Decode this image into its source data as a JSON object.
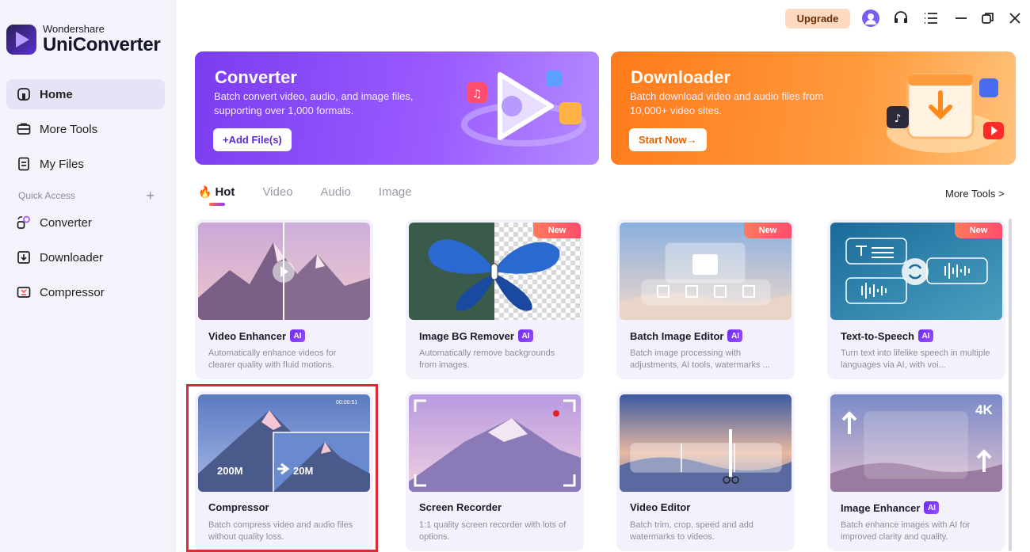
{
  "app": {
    "brand_sub": "Wondershare",
    "brand_main": "UniConverter"
  },
  "sidebar": {
    "items": [
      {
        "label": "Home",
        "icon": "home-icon"
      },
      {
        "label": "More Tools",
        "icon": "toolbox-icon"
      },
      {
        "label": "My Files",
        "icon": "file-icon"
      }
    ],
    "quick_access_label": "Quick Access",
    "quick_items": [
      {
        "label": "Converter",
        "icon": "converter-icon"
      },
      {
        "label": "Downloader",
        "icon": "download-icon"
      },
      {
        "label": "Compressor",
        "icon": "compress-icon"
      }
    ]
  },
  "topbar": {
    "upgrade_label": "Upgrade"
  },
  "banners": {
    "converter": {
      "title": "Converter",
      "desc": "Batch convert video, audio, and image files, supporting over 1,000 formats.",
      "button": "+Add File(s)"
    },
    "downloader": {
      "title": "Downloader",
      "desc": "Batch download video and audio files from 10,000+ video sites.",
      "button": "Start Now→"
    }
  },
  "tabs": [
    "Hot",
    "Video",
    "Audio",
    "Image"
  ],
  "more_tools_label": "More Tools >",
  "cards": [
    {
      "title": "Video Enhancer",
      "ai": "AI",
      "desc": "Automatically enhance videos for clearer quality with fluid motions."
    },
    {
      "title": "Image BG Remover",
      "ai": "AI",
      "new": "New",
      "desc": "Automatically remove backgrounds from images."
    },
    {
      "title": "Batch Image Editor",
      "ai": "AI",
      "new": "New",
      "desc": "Batch image processing with adjustments, AI tools, watermarks ..."
    },
    {
      "title": "Text-to-Speech",
      "ai": "AI",
      "new": "New",
      "desc": "Turn text into lifelike speech in multiple languages via AI, with voi..."
    },
    {
      "title": "Compressor",
      "desc": "Batch compress video and audio files without quality loss.",
      "thumb_time": "00:00:51",
      "size_from": "200M",
      "size_to": "20M"
    },
    {
      "title": "Screen Recorder",
      "desc": "1:1 quality screen recorder with lots of options."
    },
    {
      "title": "Video Editor",
      "desc": "Batch trim, crop, speed and add watermarks to videos."
    },
    {
      "title": "Image Enhancer",
      "ai": "AI",
      "desc": "Batch enhance images with AI for improved clarity and quality.",
      "badge": "4K"
    }
  ]
}
